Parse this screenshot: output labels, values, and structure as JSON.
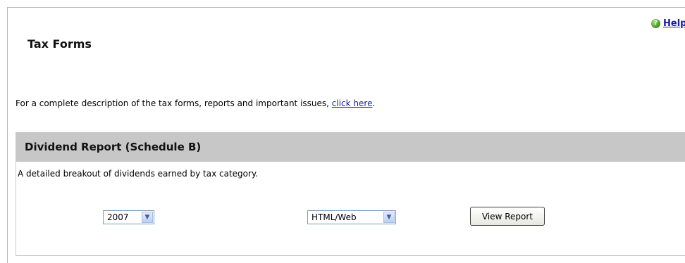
{
  "help": {
    "label": "Help",
    "icon": "help-icon"
  },
  "page_title": "Tax Forms",
  "intro": {
    "text": "For a complete description of the tax forms, reports and important issues, ",
    "link_text": "click here",
    "suffix": "."
  },
  "section": {
    "title": "Dividend Report (Schedule B)",
    "description": "A detailed breakout of dividends earned by tax category.",
    "year_select": {
      "value": "2007"
    },
    "format_select": {
      "value": "HTML/Web"
    },
    "view_button": "View Report"
  },
  "colors": {
    "link": "#1a1aa6",
    "section_header_bg": "#c7c7c7",
    "select_border": "#7f9db9"
  }
}
